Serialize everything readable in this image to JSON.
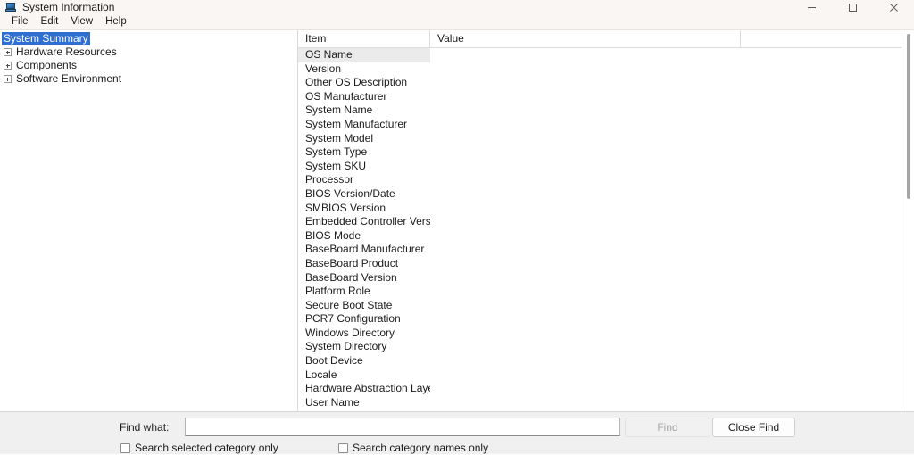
{
  "window": {
    "title": "System Information",
    "icon": "system-information-icon",
    "controls": {
      "minimize": "minimize-icon",
      "maximize": "maximize-icon",
      "close": "close-icon"
    }
  },
  "menubar": {
    "items": [
      {
        "label": "File"
      },
      {
        "label": "Edit"
      },
      {
        "label": "View"
      },
      {
        "label": "Help"
      }
    ]
  },
  "tree": {
    "items": [
      {
        "label": "System Summary",
        "expandable": false,
        "selected": true
      },
      {
        "label": "Hardware Resources",
        "expandable": true,
        "selected": false
      },
      {
        "label": "Components",
        "expandable": true,
        "selected": false
      },
      {
        "label": "Software Environment",
        "expandable": true,
        "selected": false
      }
    ]
  },
  "list": {
    "columns": [
      {
        "label": "Item"
      },
      {
        "label": "Value"
      }
    ],
    "rows": [
      {
        "item": "OS Name",
        "value": "",
        "selected": true
      },
      {
        "item": "Version",
        "value": "",
        "selected": false
      },
      {
        "item": "Other OS Description",
        "value": "",
        "selected": false
      },
      {
        "item": "OS Manufacturer",
        "value": "",
        "selected": false
      },
      {
        "item": "System Name",
        "value": "",
        "selected": false
      },
      {
        "item": "System Manufacturer",
        "value": "",
        "selected": false
      },
      {
        "item": "System Model",
        "value": "",
        "selected": false
      },
      {
        "item": "System Type",
        "value": "",
        "selected": false
      },
      {
        "item": "System SKU",
        "value": "",
        "selected": false
      },
      {
        "item": "Processor",
        "value": "",
        "selected": false
      },
      {
        "item": "BIOS Version/Date",
        "value": "",
        "selected": false
      },
      {
        "item": "SMBIOS Version",
        "value": "",
        "selected": false
      },
      {
        "item": "Embedded Controller Version",
        "value": "",
        "selected": false
      },
      {
        "item": "BIOS Mode",
        "value": "",
        "selected": false
      },
      {
        "item": "BaseBoard Manufacturer",
        "value": "",
        "selected": false
      },
      {
        "item": "BaseBoard Product",
        "value": "",
        "selected": false
      },
      {
        "item": "BaseBoard Version",
        "value": "",
        "selected": false
      },
      {
        "item": "Platform Role",
        "value": "",
        "selected": false
      },
      {
        "item": "Secure Boot State",
        "value": "",
        "selected": false
      },
      {
        "item": "PCR7 Configuration",
        "value": "",
        "selected": false
      },
      {
        "item": "Windows Directory",
        "value": "",
        "selected": false
      },
      {
        "item": "System Directory",
        "value": "",
        "selected": false
      },
      {
        "item": "Boot Device",
        "value": "",
        "selected": false
      },
      {
        "item": "Locale",
        "value": "",
        "selected": false
      },
      {
        "item": "Hardware Abstraction Layer",
        "value": "",
        "selected": false
      },
      {
        "item": "User Name",
        "value": "",
        "selected": false
      }
    ]
  },
  "findbar": {
    "find_label": "Find what:",
    "find_input_value": "",
    "find_input_placeholder": "",
    "find_button": "Find",
    "find_button_enabled": false,
    "close_find_button": "Close Find",
    "checkbox_selected_category": "Search selected category only",
    "checkbox_selected_category_checked": false,
    "checkbox_category_names": "Search category names only",
    "checkbox_category_names_checked": false
  },
  "colors": {
    "selection_blue": "#2f6fd0",
    "row_selection_gray": "#ebebeb",
    "titlebar_bg": "#f9f6f4",
    "findbar_bg": "#f0f0f0"
  }
}
